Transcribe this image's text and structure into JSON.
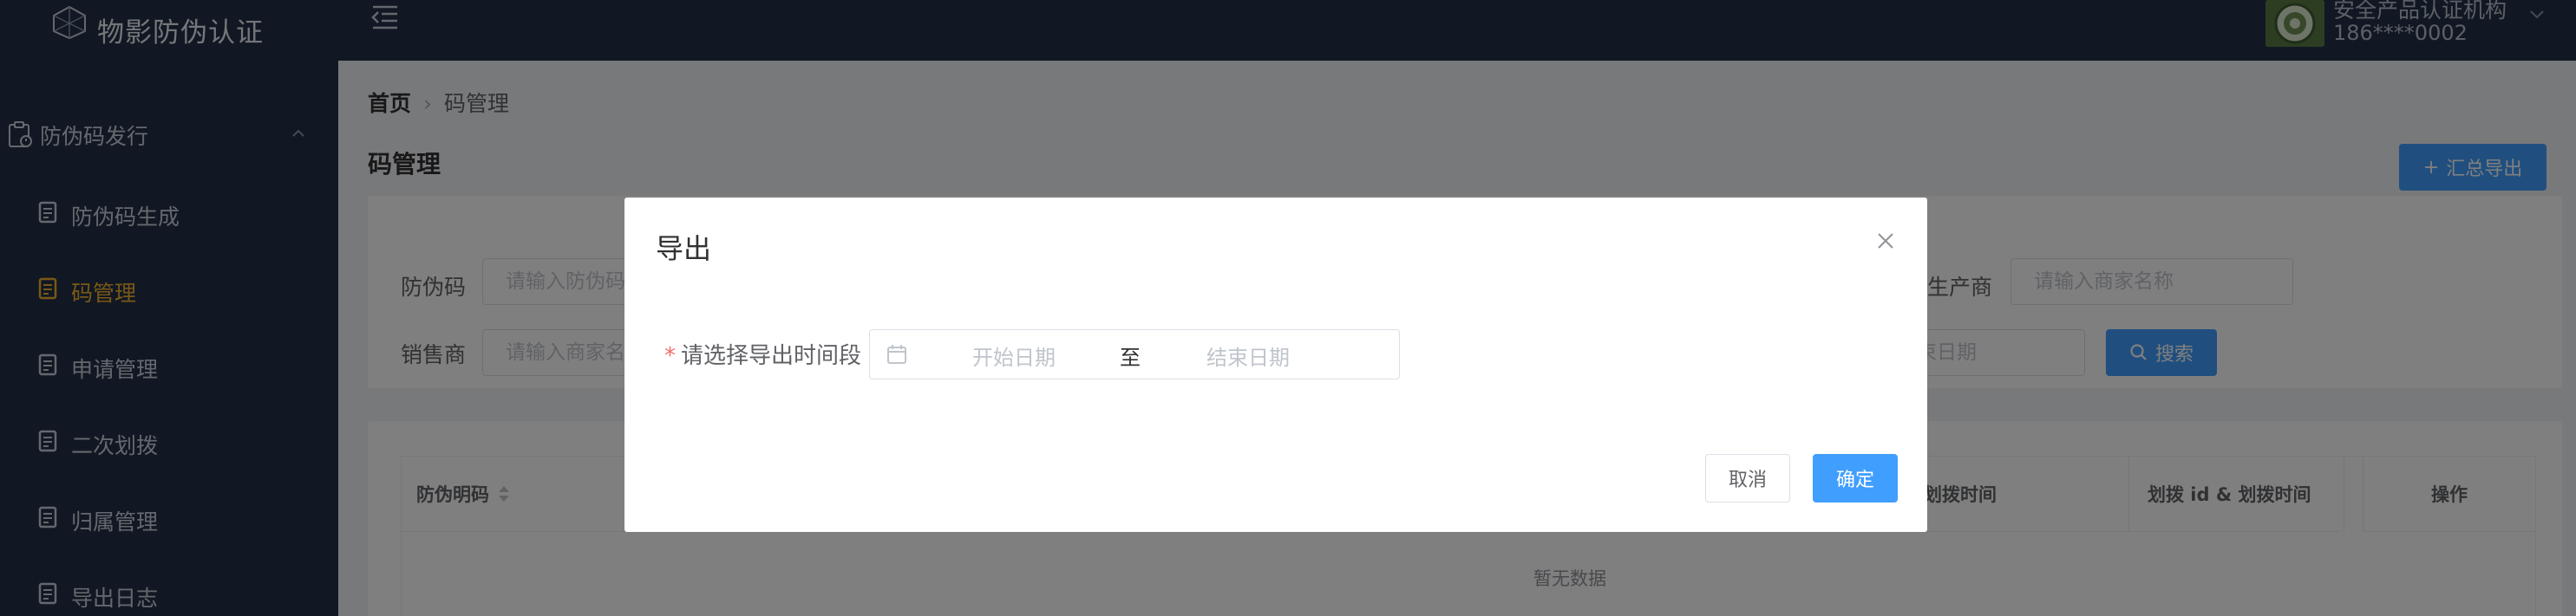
{
  "app": {
    "title": "物影防伪认证",
    "accent_color": "#409eff",
    "sidebar_bg": "#233146",
    "active_color": "#f2b02e"
  },
  "sidebar": {
    "group": {
      "label": "防伪码发行",
      "icon": "clipboard-icon"
    },
    "items": [
      {
        "label": "防伪码生成",
        "icon": "document-icon"
      },
      {
        "label": "码管理",
        "icon": "document-icon",
        "active": true
      },
      {
        "label": "申请管理",
        "icon": "document-icon"
      },
      {
        "label": "二次划拨",
        "icon": "document-icon"
      },
      {
        "label": "归属管理",
        "icon": "document-icon"
      },
      {
        "label": "导出日志",
        "icon": "document-icon"
      }
    ]
  },
  "header": {
    "user_name": "安全产品认证机构",
    "user_phone": "186****0002"
  },
  "breadcrumb": {
    "home": "首页",
    "current": "码管理"
  },
  "page": {
    "title": "码管理",
    "export_all_button": "汇总导出"
  },
  "filters": {
    "code_label": "防伪码",
    "code_placeholder": "请输入防伪码",
    "producer_label": "生产商",
    "producer_placeholder": "请输入商家名称",
    "seller_label": "销售商",
    "seller_placeholder": "请输入商家名称",
    "date_placeholder": "结束日期",
    "search_button": "搜索"
  },
  "table": {
    "columns": [
      "防伪明码",
      "划拨时间",
      "划拨 id & 划拨时间",
      "操作"
    ],
    "empty_text": "暂无数据"
  },
  "dialog": {
    "title": "导出",
    "required_mark": "*",
    "field_label": "请选择导出时间段",
    "start_placeholder": "开始日期",
    "range_separator": "至",
    "end_placeholder": "结束日期",
    "cancel_label": "取消",
    "confirm_label": "确定"
  }
}
